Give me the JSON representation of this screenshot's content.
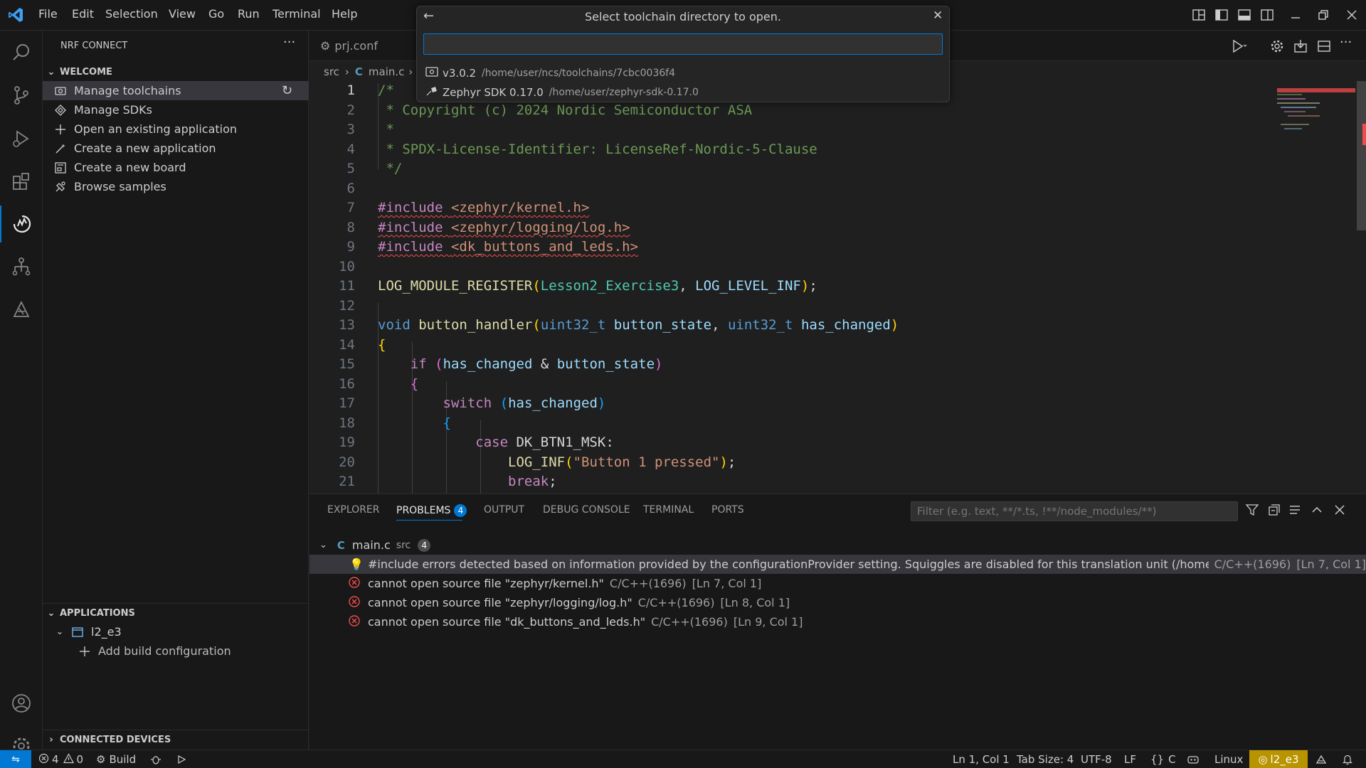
{
  "menu": [
    "File",
    "Edit",
    "Selection",
    "View",
    "Go",
    "Run",
    "Terminal",
    "Help"
  ],
  "quickpick": {
    "title": "Select toolchain directory to open.",
    "input_value": "",
    "items": [
      {
        "name": "v3.0.2",
        "desc": "/home/user/ncs/toolchains/7cbc0036f4"
      },
      {
        "name": "Zephyr SDK 0.17.0",
        "desc": "/home/user/zephyr-sdk-0.17.0"
      }
    ]
  },
  "sidebar": {
    "title": "NRF CONNECT",
    "welcome_header": "WELCOME",
    "welcome_items": [
      {
        "label": "Manage toolchains",
        "icon": "toolchain-icon"
      },
      {
        "label": "Manage SDKs",
        "icon": "sdk-icon"
      },
      {
        "label": "Open an existing application",
        "icon": "plus-icon"
      },
      {
        "label": "Create a new application",
        "icon": "wand-icon"
      },
      {
        "label": "Create a new board",
        "icon": "board-icon"
      },
      {
        "label": "Browse samples",
        "icon": "samples-icon"
      }
    ],
    "applications_header": "APPLICATIONS",
    "app_name": "l2_e3",
    "add_build": "Add build configuration",
    "connected_header": "CONNECTED DEVICES"
  },
  "tabs": {
    "prj": "prj.conf"
  },
  "breadcrumb": {
    "folder": "src",
    "c_letter": "C",
    "file": "main.c"
  },
  "editor": {
    "line_numbers": [
      "1",
      "2",
      "3",
      "4",
      "5",
      "6",
      "7",
      "8",
      "9",
      "10",
      "11",
      "12",
      "13",
      "14",
      "15",
      "16",
      "17",
      "18",
      "19",
      "20",
      "21"
    ]
  },
  "panel": {
    "tabs": [
      "EXPLORER",
      "PROBLEMS",
      "OUTPUT",
      "DEBUG CONSOLE",
      "TERMINAL",
      "PORTS"
    ],
    "problems_count": "4",
    "filter_placeholder": "Filter (e.g. text, **/*.ts, !**/node_modules/**)",
    "file_row": {
      "c_letter": "C",
      "name": "main.c",
      "folder": "src",
      "count": "4"
    },
    "problems": [
      {
        "type": "info",
        "message": "#include errors detected based on information provided by the configurationProvider setting. Squiggles are disabled for this translation unit (/home/user/zeph...",
        "source": "C/C++(1696)",
        "loc": "[Ln 7, Col 1]"
      },
      {
        "type": "error",
        "message": "cannot open source file \"zephyr/kernel.h\"",
        "source": "C/C++(1696)",
        "loc": "[Ln 7, Col 1]"
      },
      {
        "type": "error",
        "message": "cannot open source file \"zephyr/logging/log.h\"",
        "source": "C/C++(1696)",
        "loc": "[Ln 8, Col 1]"
      },
      {
        "type": "error",
        "message": "cannot open source file \"dk_buttons_and_leds.h\"",
        "source": "C/C++(1696)",
        "loc": "[Ln 9, Col 1]"
      }
    ]
  },
  "status": {
    "errors": "4",
    "warnings": "0",
    "build": "Build",
    "position": "Ln 1, Col 1",
    "tabsize": "Tab Size: 4",
    "encoding": "UTF-8",
    "eol": "LF",
    "language": "C",
    "os": "Linux",
    "app": "l2_e3"
  },
  "colors": {
    "accent": "#0078d4",
    "error": "#f14c4c",
    "statusbar_app": "#b89500",
    "statusbar_remote": "#0078d4"
  }
}
